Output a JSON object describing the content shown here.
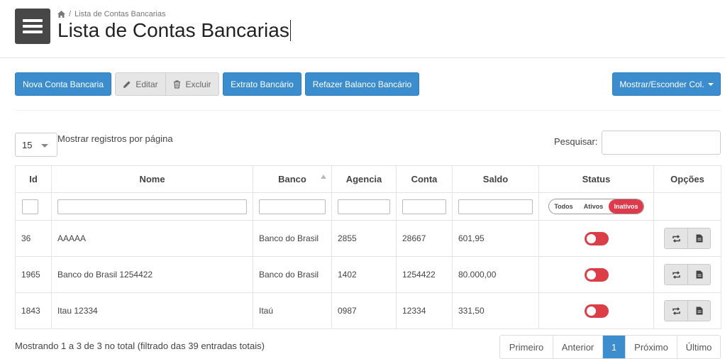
{
  "breadcrumb": {
    "current": "Lista de Contas Bancarias"
  },
  "page": {
    "title": "Lista de Contas Bancarias"
  },
  "toolbar": {
    "new_label": "Nova Conta Bancaria",
    "edit_label": "Editar",
    "delete_label": "Excluir",
    "statement_label": "Extrato Bancário",
    "rebalance_label": "Refazer Balanco Bancário",
    "columns_label": "Mostrar/Esconder Col."
  },
  "length": {
    "value": "15",
    "label": "Mostrar registros por página"
  },
  "search": {
    "label": "Pesquisar:",
    "placeholder": ""
  },
  "table": {
    "headers": {
      "id": "Id",
      "nome": "Nome",
      "banco": "Banco",
      "agencia": "Agencia",
      "conta": "Conta",
      "saldo": "Saldo",
      "status": "Status",
      "opcoes": "Opções"
    },
    "status_filter": {
      "all": "Todos",
      "active": "Ativos",
      "inactive": "Inativos",
      "selected": "Inativos"
    },
    "rows": [
      {
        "id": "36",
        "nome": "AAAAA",
        "banco": "Banco do Brasil",
        "agencia": "2855",
        "conta": "28667",
        "saldo": "601,95",
        "active": false
      },
      {
        "id": "1965",
        "nome": "Banco do Brasil 1254422",
        "banco": "Banco do Brasil",
        "agencia": "1402",
        "conta": "1254422",
        "saldo": "80.000,00",
        "active": false
      },
      {
        "id": "1843",
        "nome": "Itau 12334",
        "banco": "Itaú",
        "agencia": "0987",
        "conta": "12334",
        "saldo": "331,50",
        "active": false
      }
    ]
  },
  "footer": {
    "info": "Mostrando 1 a 3 de 3 no total (filtrado das 39 entradas totais)",
    "pager": {
      "first": "Primeiro",
      "prev": "Anterior",
      "current": "1",
      "next": "Próximo",
      "last": "Último"
    }
  },
  "colors": {
    "primary": "#3c8dcd",
    "danger": "#dc3e48",
    "menu": "#474747"
  },
  "icons": {
    "menu": "hamburger-icon",
    "home": "home-icon",
    "edit": "pencil-icon",
    "delete": "trash-icon",
    "caret": "caret-down-icon",
    "switch": "repeat-icon",
    "document": "document-icon"
  }
}
